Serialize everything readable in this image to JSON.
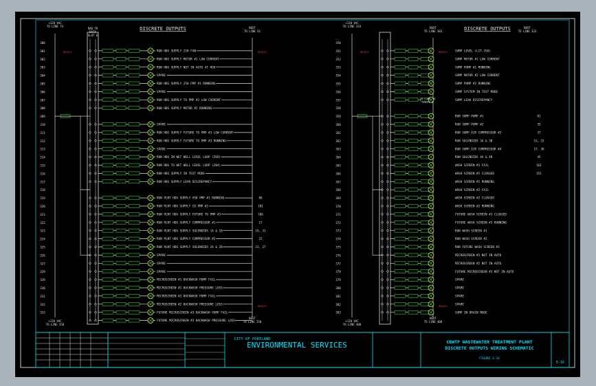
{
  "left": {
    "supply_top": "+120 VAC\nTO LINE 74",
    "neutral_top": "NEUT\nTO LINE 61",
    "header": "DISCRETE OUTPUTS",
    "card_label": "RAD TR\nDATA\nSLOT 6",
    "supply_bottom": "+120 VAC\nTO LINE 350",
    "neutral_bottom": "NEUT\nTO LINE 350",
    "lines": [
      "300",
      "301",
      "302",
      "303",
      "304",
      "305",
      "306",
      "307",
      "308",
      "309",
      "310",
      "311",
      "312",
      "313",
      "314",
      "315",
      "316",
      "317",
      "318",
      "319",
      "320",
      "321",
      "322",
      "323",
      "324",
      "325",
      "326",
      "327",
      "328",
      "329",
      "330",
      "331",
      "332",
      "333"
    ],
    "rows": [
      {
        "line": "301",
        "desc": "RUN HDG SUPPLY 250 FAN"
      },
      {
        "line": "302",
        "desc": "RUN HDG SUPPLY MOTOR #1 LOW CURRENT"
      },
      {
        "line": "303",
        "desc": "RUN HDG SUPPLY NOT IN AUTO AT HDO"
      },
      {
        "line": "304",
        "desc": "SPARE"
      },
      {
        "line": "305",
        "desc": "RUN HDG SUPPLY 250 FMP #1 RUNNING"
      },
      {
        "line": "306",
        "desc": "SPARE"
      },
      {
        "line": "307",
        "desc": "RUN HDG SUPPLY TO PMP #2 LOW CURRENT"
      },
      {
        "line": "308",
        "desc": "RUN HDG SUPPLY MOTOR #2 RUNNING"
      },
      {
        "line": "310",
        "desc": "SPARE"
      },
      {
        "line": "311",
        "desc": "RUN HDG SUPPLY FUTURE TO PMP #3 LOW CURRENT"
      },
      {
        "line": "312",
        "desc": "RUN HDG SUPPLY FUTURE TO PMP #3 RUNNING"
      },
      {
        "line": "313",
        "desc": "SPARE"
      },
      {
        "line": "314",
        "desc": "RUN HDG IN WET WELL LEVEL LOOP (ZOO)"
      },
      {
        "line": "315",
        "desc": "RUN HDG TO WET WELL LEVEL LOOP (Z04)"
      },
      {
        "line": "316",
        "desc": "RUN HDG SUPPLY IN TEST MODE"
      },
      {
        "line": "317",
        "desc": "RUN HDG SUPPLY LEAK DISCREPANCY"
      },
      {
        "line": "319",
        "desc": "RUN PLNT HDG SUPPLY VSD PMP #1 RUNNING"
      },
      {
        "line": "320",
        "desc": "RUN PLNT HDG SUPPLY CD PMP #2"
      },
      {
        "line": "321",
        "desc": "RUN PLNT HDG SUPPLY FUTURE TO PMP #3"
      },
      {
        "line": "322",
        "desc": "RUN PLNT HDG SUPPLY COMPRESSOR #1"
      },
      {
        "line": "323",
        "desc": "RUN PLNT HDG SUPPLY SOLENOIDS 1A & 1B"
      },
      {
        "line": "324",
        "desc": "RUN PLNT HDG SUPPLY COMPRESSOR #2"
      },
      {
        "line": "325",
        "desc": "RUN PLNT HDG SUPPLY SOLENOIDS 2A & 2B"
      },
      {
        "line": "326",
        "desc": "SPARE"
      },
      {
        "line": "327",
        "desc": "SPARE"
      },
      {
        "line": "328",
        "desc": "SPARE"
      },
      {
        "line": "329",
        "desc": "MICROSCREEN #1 BACKWASH PUMP FAIL"
      },
      {
        "line": "330",
        "desc": "MICROSCREEN #1 BACKWASH PRESSURE LOSS"
      },
      {
        "line": "331",
        "desc": "MICROSCREEN #2 BACKWASH PUMP FAIL"
      },
      {
        "line": "332",
        "desc": "MICROSCREEN #2 BACKWASH PRESSURE LOSS"
      },
      {
        "line": "333",
        "desc": "FUTURE MICROSCREEN #3 BACKWASH PUMP FAIL"
      },
      {
        "line": "334",
        "desc": "FUTURE MICROSCREEN #3 BACKWASH PRESSURE LOSS"
      }
    ],
    "refs": [
      "86",
      "101",
      "106",
      "17",
      "19, 31",
      "22",
      "23, 27"
    ]
  },
  "right": {
    "supply_top": "+120 VAC\nTO LINE 333",
    "neutral_top": "NEUT\nTO LINE 302",
    "header": "DISCRETE OUTPUTS",
    "neutral_top_right": "NEUT\nTO LINE 333",
    "supply_bottom": "+120 VAC\nTO LINE 400",
    "neutral_bottom": "NEUT\nTO LINE 400",
    "to_line_note": "TO LINE 36\nCR631-2",
    "lines": [
      "350",
      "351",
      "352",
      "353",
      "354",
      "355",
      "356",
      "357",
      "358",
      "359",
      "360",
      "361",
      "362",
      "363",
      "364",
      "365",
      "366",
      "367",
      "368",
      "369",
      "370",
      "371",
      "372",
      "373",
      "374",
      "375",
      "376",
      "377",
      "378",
      "379",
      "380",
      "381",
      "382",
      "383"
    ],
    "rows": [
      {
        "line": "351",
        "desc": "SUMP LEVEL (LIT-350)"
      },
      {
        "line": "352",
        "desc": "SUMP MOTOR #1 LOW CURRENT"
      },
      {
        "line": "353",
        "desc": "SUMP PUMP #1 RUNNING"
      },
      {
        "line": "354",
        "desc": "SUMP MOTOR #2 LOW CURRENT"
      },
      {
        "line": "355",
        "desc": "SUMP PUMP #2 RUNNING"
      },
      {
        "line": "356",
        "desc": "SUMP SYSTEM IN TEST MODE"
      },
      {
        "line": "357",
        "desc": "SUMP LEAK DISCREPANCY"
      },
      {
        "line": "359",
        "desc": "RUN SUMP PUMP #1"
      },
      {
        "line": "360",
        "desc": "RUN SUMP PUMP #2"
      },
      {
        "line": "361",
        "desc": "RUN SUMP AIR COMPRESSOR #3"
      },
      {
        "line": "362",
        "desc": "RUN SOLENOIDS 3A & 3B"
      },
      {
        "line": "363",
        "desc": "RUN SUMP AIR COMPRESSOR #4"
      },
      {
        "line": "364",
        "desc": "RUN SOLENOIDS 4A & 4B"
      },
      {
        "line": "365",
        "desc": "WASH SCREEN #1 FAIL"
      },
      {
        "line": "366",
        "desc": "WASH SCREEN #1 CLOGGED"
      },
      {
        "line": "367",
        "desc": "WASH SCREEN #1 RUNNING"
      },
      {
        "line": "368",
        "desc": "WASH SCREEN #2 FAIL"
      },
      {
        "line": "369",
        "desc": "WASH SCREEN #2 CLOGGED"
      },
      {
        "line": "370",
        "desc": "WASH SCREEN #2 RUNNING"
      },
      {
        "line": "371",
        "desc": "FUTURE WASH SCREEN #3 CLOGGED"
      },
      {
        "line": "372",
        "desc": "FUTURE WASH SCREEN #3 RUNNING"
      },
      {
        "line": "373",
        "desc": "RUN WASH SCREEN #1"
      },
      {
        "line": "374",
        "desc": "RUN WASH SCREEN #2"
      },
      {
        "line": "375",
        "desc": "RUN FUTURE WASH SCREEN #3"
      },
      {
        "line": "376",
        "desc": "MICROSCREEN #1 NOT IN AUTO"
      },
      {
        "line": "377",
        "desc": "MICROSCREEN #2 NOT IN AUTO"
      },
      {
        "line": "378",
        "desc": "FUTURE MICROSCREEN #3 NOT IN AUTO"
      },
      {
        "line": "379",
        "desc": "SPARE"
      },
      {
        "line": "380",
        "desc": "SPARE"
      },
      {
        "line": "381",
        "desc": "SPARE"
      },
      {
        "line": "382",
        "desc": "SPARE"
      },
      {
        "line": "383",
        "desc": "SUMP IN DRAIN MODE"
      }
    ],
    "refs": [
      "81",
      "35",
      "37",
      "31, 33",
      "37, 38",
      "45",
      "161",
      "151"
    ]
  },
  "title_block": {
    "city": "CITY OF PORTLAND",
    "bureau": "ENVIRONMENTAL SERVICES",
    "plant_title": "CBWTP WASTEWATER TREATMENT PLANT",
    "drawing_title": "DISCRETE OUTPUTS WIRING SCHEMATIC",
    "figure": "FIGURE 3-16",
    "sheet": "E-16"
  },
  "colors": {
    "background": "#000000",
    "frame": "#c8c8c8",
    "wire": "#e0e0e0",
    "cyan": "#00e5ff",
    "green": "#49e049",
    "yellow": "#ffff44",
    "red": "#ff3b3b",
    "outer": "#a9b3bb"
  }
}
